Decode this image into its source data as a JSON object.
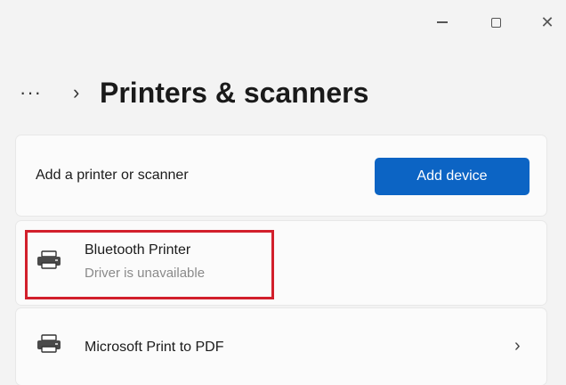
{
  "window": {
    "minimize_icon": "minimize-icon",
    "maximize_icon": "maximize-icon",
    "close_icon": "close-icon",
    "close_glyph": "✕"
  },
  "header": {
    "more_glyph": "···",
    "chevron_glyph": "›",
    "title": "Printers & scanners"
  },
  "add_section": {
    "label": "Add a printer or scanner",
    "button_label": "Add device",
    "button_color": "#0c64c4"
  },
  "printers": [
    {
      "name": "Bluetooth Printer",
      "status": "Driver is unavailable",
      "icon": "printer-icon",
      "highlighted": true
    },
    {
      "name": "Microsoft Print to PDF",
      "status": "",
      "icon": "printer-icon",
      "chevron": "›"
    }
  ],
  "colors": {
    "highlight_border": "#d21f2b",
    "background": "#f3f3f3",
    "card": "#fbfbfb"
  }
}
